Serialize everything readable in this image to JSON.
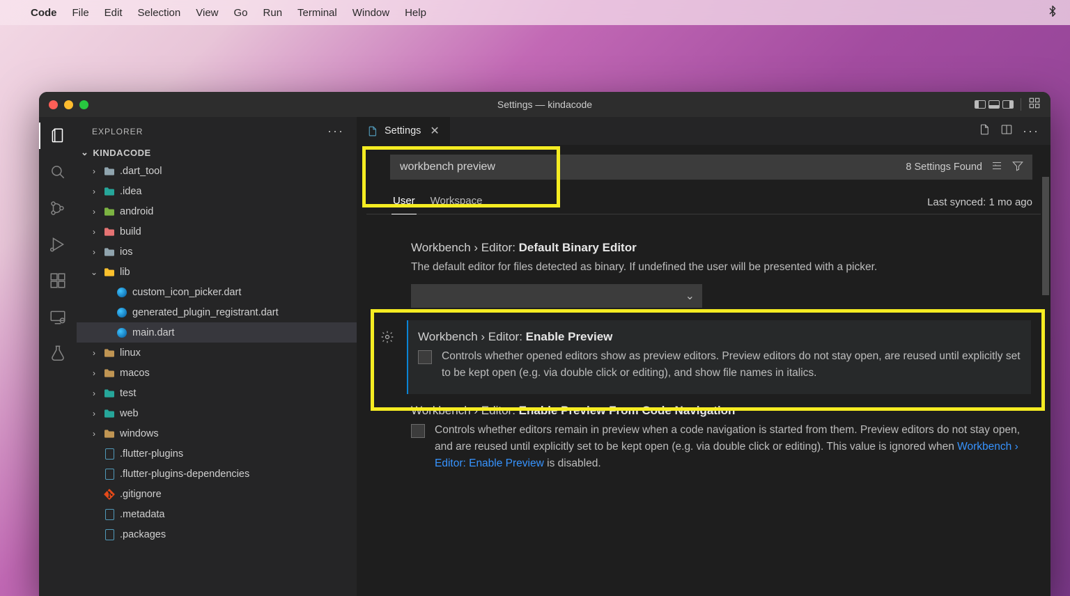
{
  "mac_menu": {
    "app": "Code",
    "items": [
      "File",
      "Edit",
      "Selection",
      "View",
      "Go",
      "Run",
      "Terminal",
      "Window",
      "Help"
    ]
  },
  "window": {
    "title": "Settings — kindacode"
  },
  "sidebar": {
    "header": "EXPLORER",
    "project": "KINDACODE",
    "tree": [
      {
        "type": "folder",
        "label": ".dart_tool",
        "depth": 0,
        "expanded": false,
        "cls": "grey"
      },
      {
        "type": "folder",
        "label": ".idea",
        "depth": 0,
        "expanded": false,
        "cls": "teal"
      },
      {
        "type": "folder",
        "label": "android",
        "depth": 0,
        "expanded": false,
        "cls": "green"
      },
      {
        "type": "folder",
        "label": "build",
        "depth": 0,
        "expanded": false,
        "cls": "red"
      },
      {
        "type": "folder",
        "label": "ios",
        "depth": 0,
        "expanded": false,
        "cls": "grey"
      },
      {
        "type": "folder",
        "label": "lib",
        "depth": 0,
        "expanded": true,
        "cls": "amber"
      },
      {
        "type": "dart",
        "label": "custom_icon_picker.dart",
        "depth": 1
      },
      {
        "type": "dart",
        "label": "generated_plugin_registrant.dart",
        "depth": 1
      },
      {
        "type": "dart",
        "label": "main.dart",
        "depth": 1,
        "selected": true
      },
      {
        "type": "folder",
        "label": "linux",
        "depth": 0,
        "expanded": false,
        "cls": ""
      },
      {
        "type": "folder",
        "label": "macos",
        "depth": 0,
        "expanded": false,
        "cls": ""
      },
      {
        "type": "folder",
        "label": "test",
        "depth": 0,
        "expanded": false,
        "cls": "teal"
      },
      {
        "type": "folder",
        "label": "web",
        "depth": 0,
        "expanded": false,
        "cls": "teal"
      },
      {
        "type": "folder",
        "label": "windows",
        "depth": 0,
        "expanded": false,
        "cls": ""
      },
      {
        "type": "file",
        "label": ".flutter-plugins",
        "depth": 0
      },
      {
        "type": "file",
        "label": ".flutter-plugins-dependencies",
        "depth": 0
      },
      {
        "type": "git",
        "label": ".gitignore",
        "depth": 0
      },
      {
        "type": "file",
        "label": ".metadata",
        "depth": 0
      },
      {
        "type": "file",
        "label": ".packages",
        "depth": 0
      }
    ]
  },
  "tab": {
    "label": "Settings"
  },
  "settings": {
    "search_value": "workbench preview",
    "results_count": "8 Settings Found",
    "scope_user": "User",
    "scope_workspace": "Workspace",
    "sync_status": "Last synced: 1 mo ago",
    "items": [
      {
        "crumb": "Workbench › Editor: ",
        "name": "Default Binary Editor",
        "desc": "The default editor for files detected as binary. If undefined the user will be presented with a picker.",
        "type": "dropdown"
      },
      {
        "crumb": "Workbench › Editor: ",
        "name": "Enable Preview",
        "desc": "Controls whether opened editors show as preview editors. Preview editors do not stay open, are reused until explicitly set to be kept open (e.g. via double click or editing), and show file names in italics.",
        "type": "checkbox",
        "modified": true
      },
      {
        "crumb": "Workbench › Editor: ",
        "name": "Enable Preview From Code Navigation",
        "desc_pre": "Controls whether editors remain in preview when a code navigation is started from them. Preview editors do not stay open, and are reused until explicitly set to be kept open (e.g. via double click or editing). This value is ignored when ",
        "link": "Workbench › Editor: Enable Preview",
        "desc_post": " is disabled.",
        "type": "checkbox"
      }
    ]
  }
}
